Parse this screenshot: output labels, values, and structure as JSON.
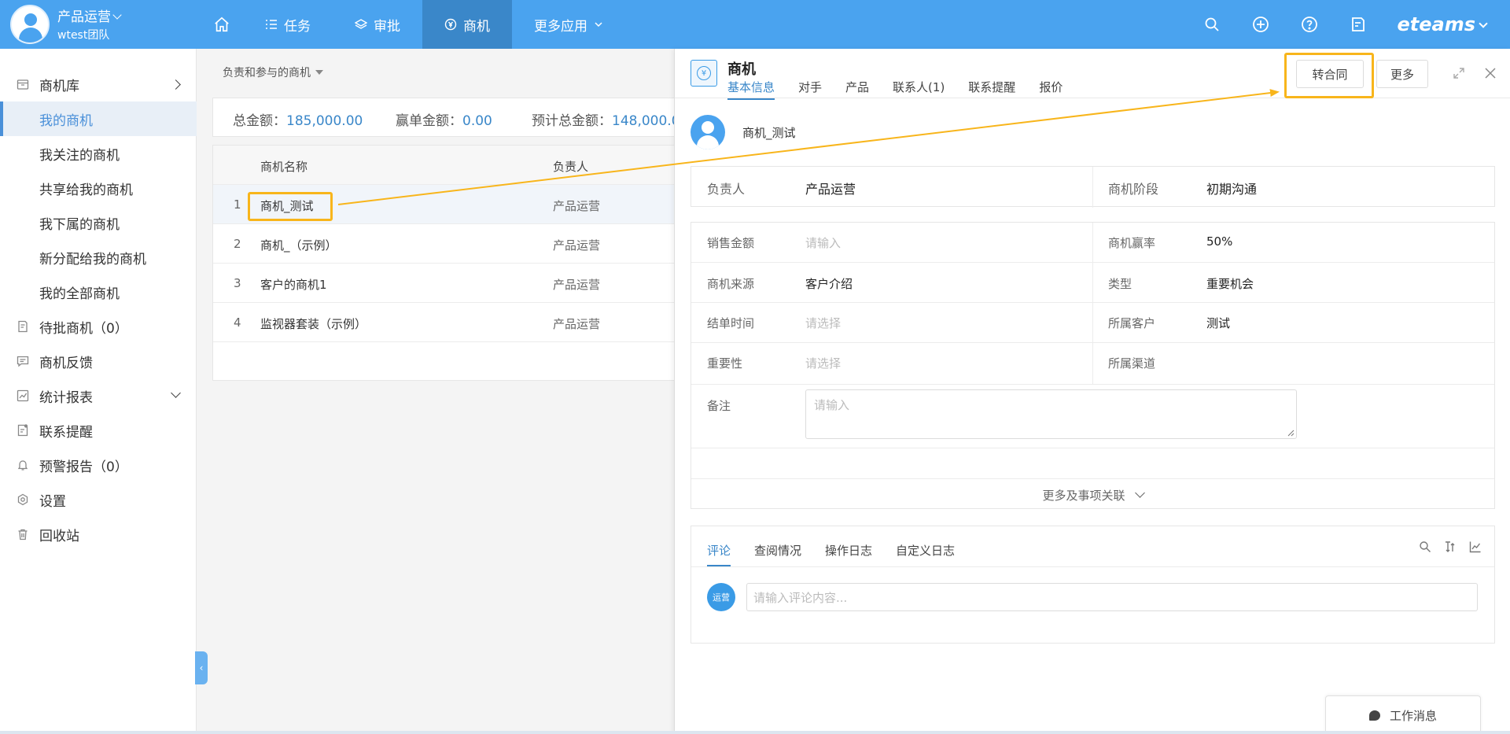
{
  "topbar": {
    "org_name": "产品运营",
    "org_team": "wtest团队",
    "nav": [
      {
        "label": "任务"
      },
      {
        "label": "审批"
      },
      {
        "label": "商机"
      },
      {
        "label": "更多应用"
      }
    ],
    "brand": "eteams",
    "accent_color": "#4aa3ef"
  },
  "sidebar": {
    "items": [
      {
        "label": "商机库",
        "icon": "box-icon"
      },
      {
        "label": "我的商机"
      },
      {
        "label": "我关注的商机"
      },
      {
        "label": "共享给我的商机"
      },
      {
        "label": "我下属的商机"
      },
      {
        "label": "新分配给我的商机"
      },
      {
        "label": "我的全部商机"
      },
      {
        "label": "待批商机（0）",
        "icon": "approval-icon"
      },
      {
        "label": "商机反馈",
        "icon": "feedback-icon"
      },
      {
        "label": "统计报表",
        "icon": "chart-icon"
      },
      {
        "label": "联系提醒",
        "icon": "reminder-icon"
      },
      {
        "label": "预警报告（0）",
        "icon": "bell-icon"
      },
      {
        "label": "设置",
        "icon": "settings-icon"
      },
      {
        "label": "回收站",
        "icon": "trash-icon"
      }
    ]
  },
  "list": {
    "filter": "负责和参与的商机",
    "summary": {
      "total_label": "总金额：",
      "total_value": "185,000.00",
      "won_label": "赢单金额：",
      "won_value": "0.00",
      "forecast_label": "预计总金额：",
      "forecast_value": "148,000.0"
    },
    "columns": [
      "商机名称",
      "负责人"
    ],
    "rows": [
      {
        "index": "1",
        "name": "商机_测试",
        "owner": "产品运营"
      },
      {
        "index": "2",
        "name": "商机_（示例）",
        "owner": "产品运营"
      },
      {
        "index": "3",
        "name": "客户的商机1",
        "owner": "产品运营"
      },
      {
        "index": "4",
        "name": "监视器套装（示例）",
        "owner": "产品运营"
      }
    ]
  },
  "detail": {
    "title": "商机",
    "tabs": [
      "基本信息",
      "对手",
      "产品",
      "联系人(1)",
      "联系提醒",
      "报价"
    ],
    "convert_button": "转合同",
    "more_button": "更多",
    "record_name": "商机_测试",
    "fields": {
      "owner_label": "负责人",
      "owner_value": "产品运营",
      "stage_label": "商机阶段",
      "stage_value": "初期沟通",
      "amount_label": "销售金额",
      "amount_placeholder": "请输入",
      "win_rate_label": "商机赢率",
      "win_rate_value": "50%",
      "source_label": "商机来源",
      "source_value": "客户介绍",
      "type_label": "类型",
      "type_value": "重要机会",
      "close_date_label": "结单时间",
      "close_date_placeholder": "请选择",
      "customer_label": "所属客户",
      "customer_value": "测试",
      "importance_label": "重要性",
      "importance_placeholder": "请选择",
      "channel_label": "所属渠道",
      "remark_label": "备注",
      "remark_placeholder": "请输入"
    },
    "more_link": "更多及事项关联",
    "comment_tabs": [
      "评论",
      "查阅情况",
      "操作日志",
      "自定义日志"
    ],
    "comment_avatar": "运营",
    "comment_placeholder": "请输入评论内容..."
  },
  "work_message": "工作消息",
  "highlight_color": "#f8b51b"
}
